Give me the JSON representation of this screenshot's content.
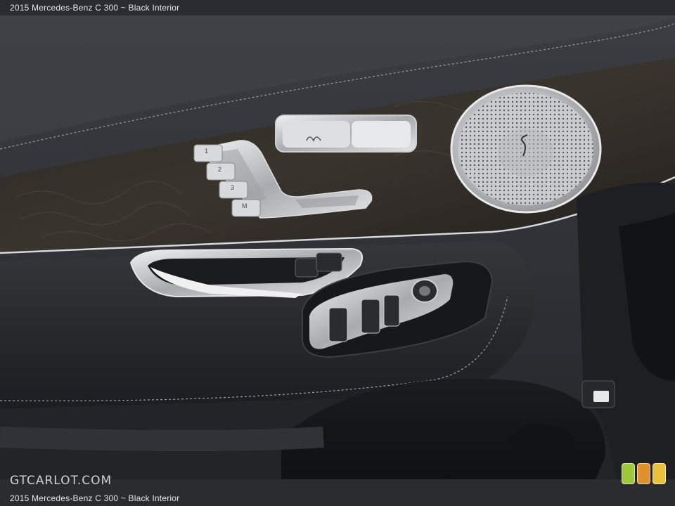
{
  "caption": {
    "top": "2015 Mercedes-Benz C 300 ~ Black Interior",
    "bottom": "2015 Mercedes-Benz C 300 ~ Black Interior"
  },
  "watermark": {
    "text": "GTCARLOT.COM"
  },
  "seat_memory": {
    "buttons": [
      "1",
      "2",
      "3",
      "M"
    ]
  },
  "colors": {
    "caption_bg": "#2a2c2f",
    "badge_green": "#9fc73b",
    "badge_orange": "#e0902a",
    "badge_yellow": "#e8c23a"
  }
}
